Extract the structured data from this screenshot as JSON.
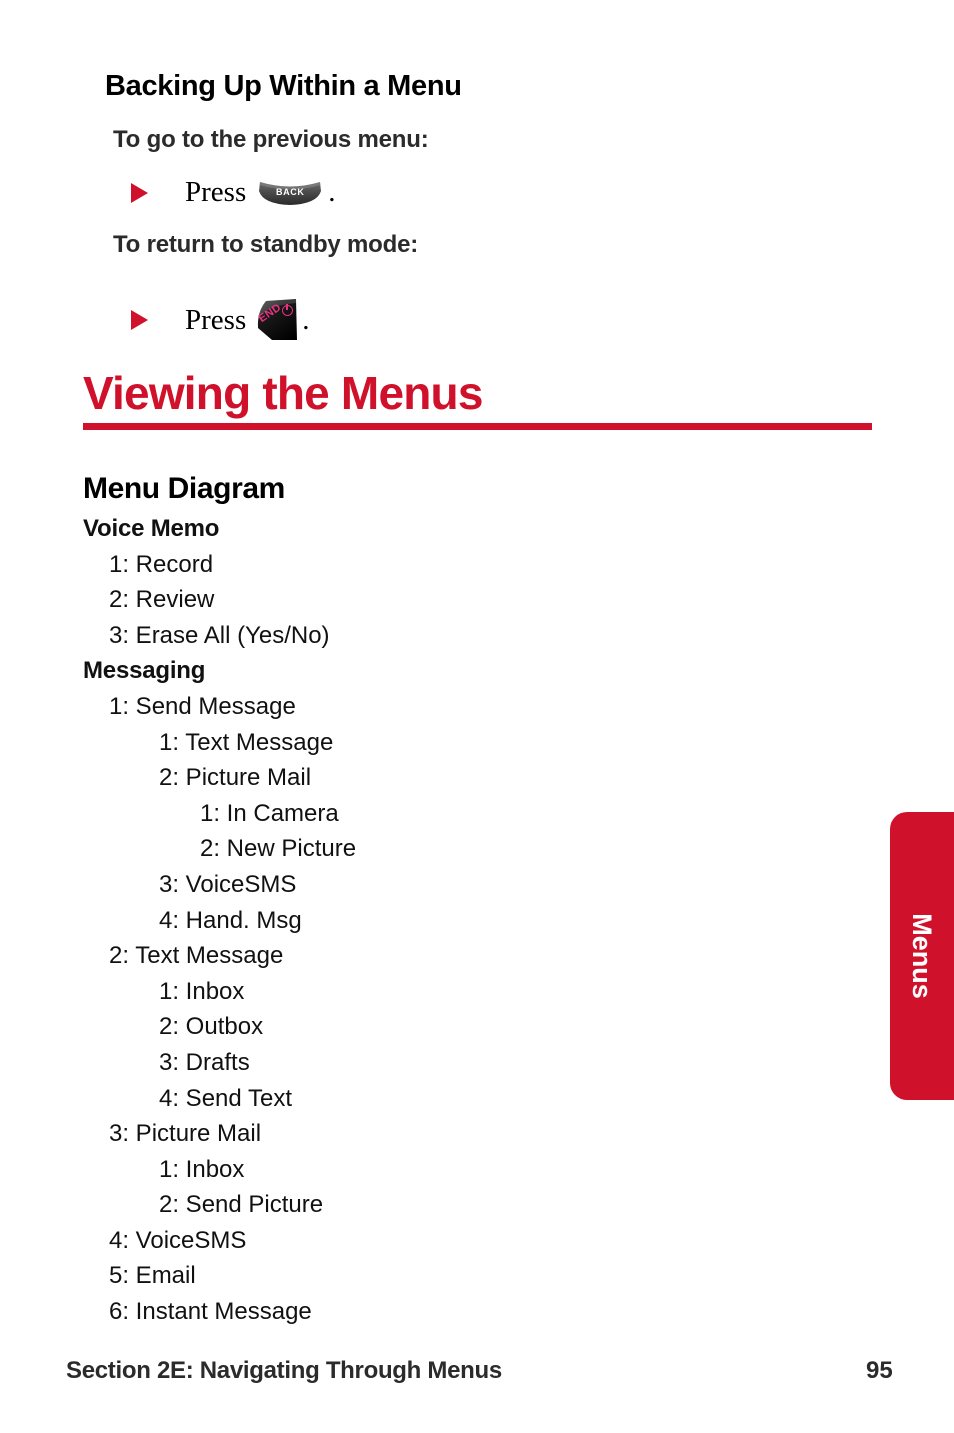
{
  "page": {
    "background_color": "#ffffff",
    "accent_color": "#D0112B",
    "text_color": "#111111"
  },
  "section": {
    "heading": "Backing Up Within a Menu",
    "steps": [
      {
        "lead": "To go to the previous menu:",
        "bullet_prefix": "Press",
        "key_label": "BACK",
        "key_icon": "back-key-icon",
        "bullet_suffix": "."
      },
      {
        "lead": "To return to standby mode:",
        "bullet_prefix": "Press",
        "key_label": "END",
        "key_icon": "end-key-icon",
        "bullet_suffix": "."
      }
    ]
  },
  "main": {
    "title": "Viewing the Menus",
    "subtitle": "Menu Diagram"
  },
  "menu_tree": [
    {
      "level": 0,
      "text": "Voice Memo"
    },
    {
      "level": 1,
      "text": "1: Record"
    },
    {
      "level": 1,
      "text": "2: Review"
    },
    {
      "level": 1,
      "text": "3: Erase All (Yes/No)"
    },
    {
      "level": 0,
      "text": "Messaging"
    },
    {
      "level": 1,
      "text": "1: Send Message"
    },
    {
      "level": 2,
      "text": "1: Text Message"
    },
    {
      "level": 2,
      "text": "2: Picture Mail"
    },
    {
      "level": 3,
      "text": "1: In Camera"
    },
    {
      "level": 3,
      "text": "2: New Picture"
    },
    {
      "level": 2,
      "text": "3: VoiceSMS"
    },
    {
      "level": 2,
      "text": "4: Hand. Msg"
    },
    {
      "level": 1,
      "text": "2: Text Message"
    },
    {
      "level": 2,
      "text": "1: Inbox"
    },
    {
      "level": 2,
      "text": "2: Outbox"
    },
    {
      "level": 2,
      "text": "3: Drafts"
    },
    {
      "level": 2,
      "text": "4: Send Text"
    },
    {
      "level": 1,
      "text": "3: Picture Mail"
    },
    {
      "level": 2,
      "text": "1: Inbox"
    },
    {
      "level": 2,
      "text": "2: Send Picture"
    },
    {
      "level": 1,
      "text": "4: VoiceSMS"
    },
    {
      "level": 1,
      "text": "5: Email"
    },
    {
      "level": 1,
      "text": "6: Instant Message"
    }
  ],
  "side_tab": {
    "label": "Menus",
    "color": "#D0112B"
  },
  "footer": {
    "section_text": "Section 2E: Navigating Through Menus",
    "page_number": "95"
  }
}
